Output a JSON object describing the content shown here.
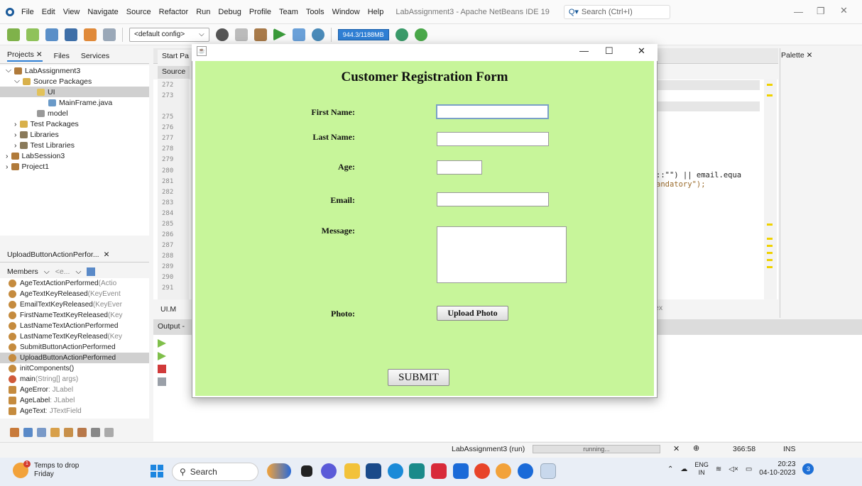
{
  "menubar": {
    "items": [
      "File",
      "Edit",
      "View",
      "Navigate",
      "Source",
      "Refactor",
      "Run",
      "Debug",
      "Profile",
      "Team",
      "Tools",
      "Window",
      "Help"
    ],
    "window_title": "LabAssignment3 - Apache NetBeans IDE 19",
    "search_placeholder": "Search (Ctrl+I)"
  },
  "toolbar": {
    "config": "<default config>",
    "memory": "944.3/1188MB"
  },
  "projects_panel": {
    "tabs": [
      "Projects",
      "Files",
      "Services"
    ],
    "tree": [
      {
        "label": "LabAssignment3",
        "level": 0,
        "icon": "project-icon"
      },
      {
        "label": "Source Packages",
        "level": 1,
        "icon": "package-folder-icon"
      },
      {
        "label": "UI",
        "level": 2,
        "icon": "package-icon",
        "selected": true
      },
      {
        "label": "MainFrame.java",
        "level": 3,
        "icon": "java-form-icon"
      },
      {
        "label": "model",
        "level": 2,
        "icon": "package-icon"
      },
      {
        "label": "Test Packages",
        "level": 1,
        "icon": "package-folder-icon"
      },
      {
        "label": "Libraries",
        "level": 1,
        "icon": "library-icon"
      },
      {
        "label": "Test Libraries",
        "level": 1,
        "icon": "library-icon"
      },
      {
        "label": "LabSession3",
        "level": 0,
        "icon": "project-icon"
      },
      {
        "label": "Project1",
        "level": 0,
        "icon": "project-icon"
      }
    ]
  },
  "navigator": {
    "title": "UploadButtonActionPerfor...",
    "members_label": "Members",
    "filter_value": "<e...",
    "members": [
      {
        "name": "AgeTextActionPerformed",
        "type": "(Actio"
      },
      {
        "name": "AgeTextKeyReleased",
        "type": "(KeyEvent"
      },
      {
        "name": "EmailTextKeyReleased",
        "type": "(KeyEver"
      },
      {
        "name": "FirstNameTextKeyReleased",
        "type": "(Key"
      },
      {
        "name": "LastNameTextActionPerformed",
        "type": ""
      },
      {
        "name": "LastNameTextKeyReleased",
        "type": "(Key"
      },
      {
        "name": "SubmitButtonActionPerformed",
        "type": ""
      },
      {
        "name": "UploadButtonActionPerformed",
        "type": "",
        "selected": true
      },
      {
        "name": "initComponents()",
        "type": ""
      },
      {
        "name": "main",
        "type": "(String[] args)"
      },
      {
        "name": "AgeError",
        "type": " : JLabel"
      },
      {
        "name": "AgeLabel",
        "type": " : JLabel"
      },
      {
        "name": "AgeText",
        "type": " : JTextField"
      }
    ]
  },
  "editor": {
    "start_tab": "Start Pa",
    "source_tab": "Source",
    "line_numbers": [
      "272",
      "273",
      "",
      "275",
      "276",
      "277",
      "278",
      "279",
      "280",
      "281",
      "282",
      "283",
      "284",
      "285",
      "286",
      "287",
      "288",
      "289",
      "290",
      "291"
    ],
    "code_line1": "::\"\") || email.equa",
    "code_line2": "andatory\");",
    "ui_tab": "UI.M",
    "next_tab": "ex",
    "output_label": "Output -"
  },
  "palette": {
    "title": "Palette"
  },
  "statusbar": {
    "run_label": "LabAssignment3 (run)",
    "progress_text": "running...",
    "caret_position": "366:58",
    "insert_mode": "INS"
  },
  "taskbar": {
    "weather_line1": "Temps to drop",
    "weather_line2": "Friday",
    "weather_badge": "1",
    "search_label": "Search",
    "lang_line1": "ENG",
    "lang_line2": "IN",
    "time": "20:23",
    "date": "04-10-2023",
    "notification_count": "3"
  },
  "dialog": {
    "form_title": "Customer Registration Form",
    "labels": {
      "first_name": "First Name:",
      "last_name": "Last Name:",
      "age": "Age:",
      "email": "Email:",
      "message": "Message:",
      "photo": "Photo:"
    },
    "values": {
      "first_name": "",
      "last_name": "",
      "age": "",
      "email": "",
      "message": ""
    },
    "upload_label": "Upload Photo",
    "submit_label": "SUBMIT",
    "colors": {
      "panel": "#c7f59a"
    }
  }
}
